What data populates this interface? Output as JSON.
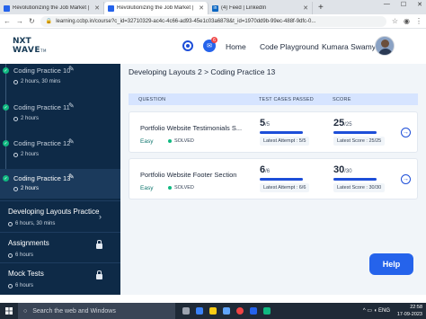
{
  "browser": {
    "tabs": [
      {
        "label": "Revolutionizing the Job Market |",
        "favicon": "ccbp-favicon",
        "active": false
      },
      {
        "label": "Revolutionizing the Job Market |",
        "favicon": "ccbp-favicon",
        "active": true
      },
      {
        "label": "(4) Feed | LinkedIn",
        "favicon": "linkedin-favicon",
        "active": false
      }
    ],
    "new_tab": "+",
    "url": "learning.ccbp.in/course?c_id=32710329-ac4c-4c66-ad93-45e1c03a6878&t_id=1970dd9b-99ec-488f-9dfc-0..."
  },
  "header": {
    "logo_line1": "NXT",
    "logo_line2": "WAVE",
    "logo_sub": "TM",
    "notification_count": "6",
    "home_label": "Home",
    "playground_label": "Code Playground",
    "user_name": "Kumara Swamy"
  },
  "sidebar": {
    "practices": [
      {
        "title": "Coding Practice 10",
        "duration": "2 hours, 30 mins",
        "completed": true,
        "active": false
      },
      {
        "title": "Coding Practice 11",
        "duration": "2 hours",
        "completed": true,
        "active": false
      },
      {
        "title": "Coding Practice 12",
        "duration": "2 hours",
        "completed": true,
        "active": false
      },
      {
        "title": "Coding Practice 13",
        "duration": "2 hours",
        "completed": true,
        "active": true
      }
    ],
    "sections": [
      {
        "title": "Developing Layouts Practice",
        "duration": "6 hours, 30 mins",
        "locked": false
      },
      {
        "title": "Assignments",
        "duration": "6 hours",
        "locked": true
      },
      {
        "title": "Mock Tests",
        "duration": "6 hours",
        "locked": true
      }
    ]
  },
  "main": {
    "breadcrumb": "Developing Layouts 2 > Coding Practice 13",
    "columns": {
      "question": "QUESTION",
      "tests": "TEST CASES PASSED",
      "score": "SCORE"
    },
    "questions": [
      {
        "title": "Portfolio Website Testimonials S...",
        "difficulty": "Easy",
        "status": "SOLVED",
        "tests_passed": "5",
        "tests_total": "/5",
        "tests_fraction": 1.0,
        "latest_attempt": "Latest Attempt : 5/5",
        "score": "25",
        "score_total": "/25",
        "score_fraction": 1.0,
        "latest_score": "Latest Score : 25/25"
      },
      {
        "title": "Portfolio Website Footer Section",
        "difficulty": "Easy",
        "status": "SOLVED",
        "tests_passed": "6",
        "tests_total": "/6",
        "tests_fraction": 1.0,
        "latest_attempt": "Latest Attempt : 6/6",
        "score": "30",
        "score_total": "/30",
        "score_fraction": 1.0,
        "latest_score": "Latest Score : 30/30"
      }
    ],
    "help_label": "Help"
  },
  "taskbar": {
    "search_placeholder": "Search the web and Windows",
    "time": "22:58",
    "date": "17-09-2023",
    "language": "ENG"
  },
  "colors": {
    "sidebar_bg": "#0e2a47",
    "accent": "#2563eb",
    "success": "#10b981",
    "table_header": "#d6e4ff"
  }
}
